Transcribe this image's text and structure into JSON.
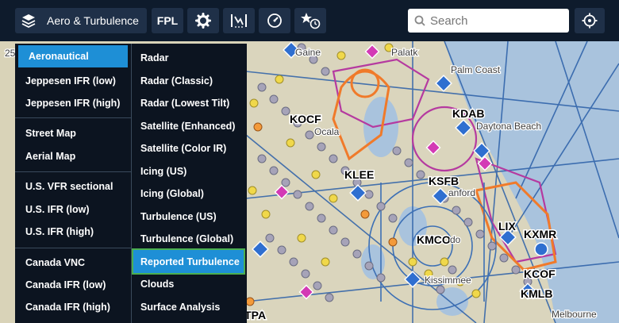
{
  "toolbar": {
    "layers_label": "Aero & Turbulence",
    "fpl_label": "FPL",
    "search_placeholder": "Search"
  },
  "menu": {
    "left": [
      {
        "label": "Aeronautical",
        "selected": true
      },
      {
        "label": "Jeppesen IFR (low)"
      },
      {
        "label": "Jeppesen IFR (high)"
      },
      {
        "label": "Street Map"
      },
      {
        "label": "Aerial Map"
      },
      {
        "label": "U.S. VFR sectional"
      },
      {
        "label": "U.S. IFR (low)"
      },
      {
        "label": "U.S. IFR (high)"
      },
      {
        "label": "Canada VNC"
      },
      {
        "label": "Canada IFR (low)"
      },
      {
        "label": "Canada IFR (high)"
      }
    ],
    "right": [
      {
        "label": "Radar"
      },
      {
        "label": "Radar (Classic)"
      },
      {
        "label": "Radar (Lowest Tilt)"
      },
      {
        "label": "Satellite (Enhanced)"
      },
      {
        "label": "Satellite (Color IR)"
      },
      {
        "label": "Icing (US)"
      },
      {
        "label": "Icing (Global)"
      },
      {
        "label": "Turbulence (US)"
      },
      {
        "label": "Turbulence (Global)"
      },
      {
        "label": "Reported Turbulence",
        "highlighted": true
      },
      {
        "label": "Clouds"
      },
      {
        "label": "Surface Analysis"
      }
    ]
  },
  "map": {
    "labels": {
      "gainesville": "Gaine",
      "palatka": "Palatk",
      "palm_coast": "Palm Coast",
      "kdab": "KDAB",
      "daytona": "Daytona Beach",
      "kocf": "KOCF",
      "ocala": "Ocala",
      "klee": "KLEE",
      "ksfb": "KSFB",
      "sanford": "anford",
      "kxmr": "KXMR",
      "kmco": "KMCO",
      "orlando": "do",
      "kissimmee": "Kissimmee",
      "kcof": "KCOF",
      "kmlb": "KMLB",
      "melbourne": "Melbourne",
      "ktpa": "KTPA",
      "lix": "LIX",
      "left_num": "25"
    }
  },
  "colors": {
    "accent": "#1e8fd6",
    "highlight_outline": "#4caf50"
  }
}
